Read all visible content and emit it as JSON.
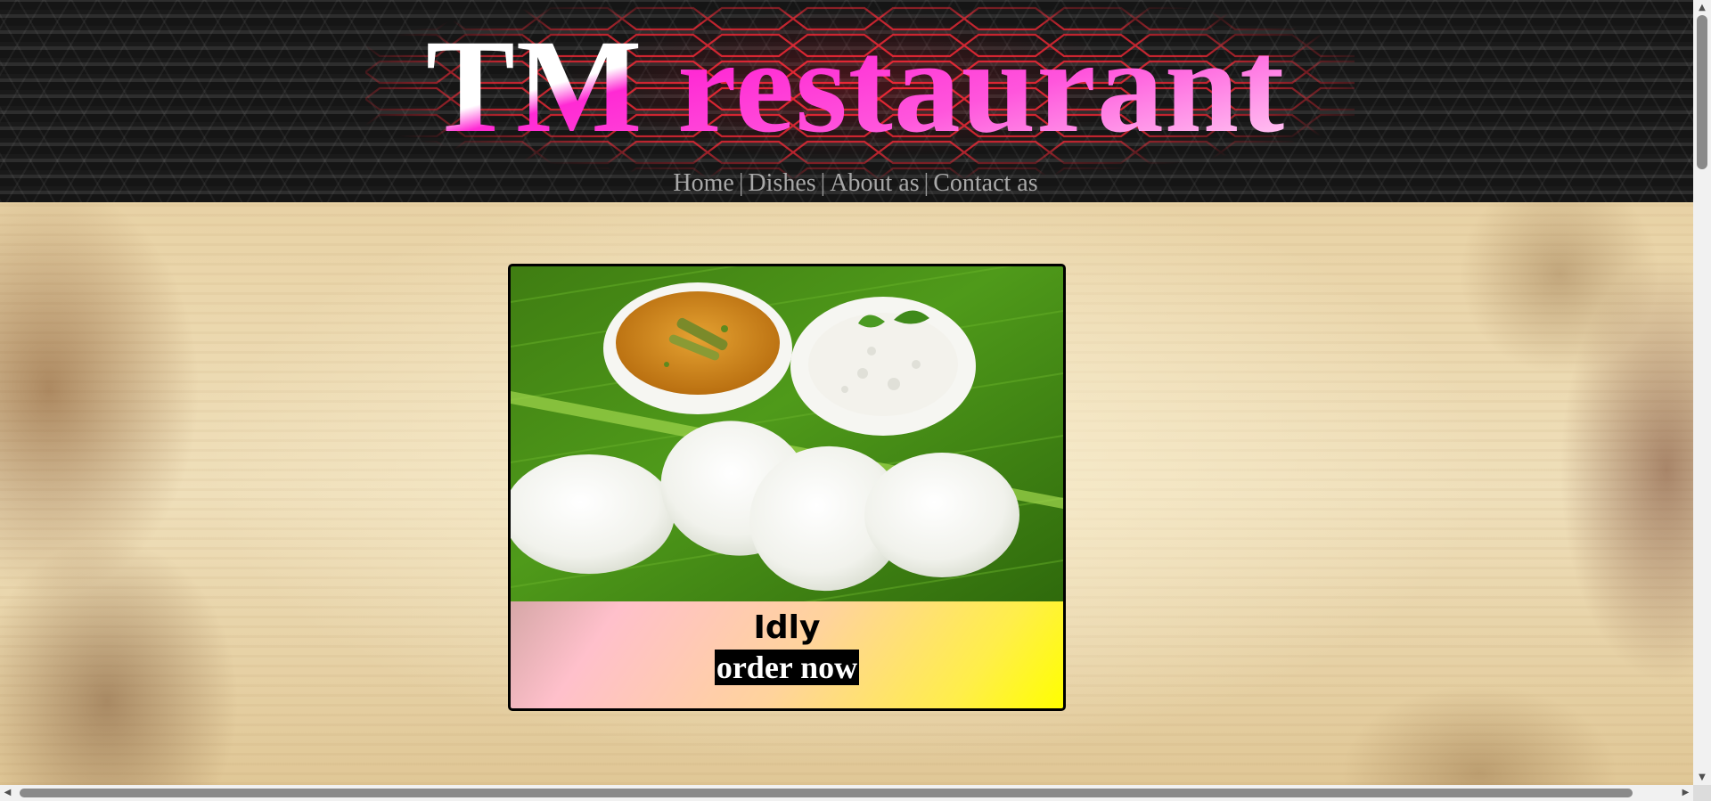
{
  "header": {
    "title": "TM restaurant",
    "nav": [
      {
        "label": "Home"
      },
      {
        "label": "Dishes"
      },
      {
        "label": "About as"
      },
      {
        "label": "Contact as"
      }
    ],
    "separator": "|"
  },
  "card": {
    "dish_name": "Idly",
    "order_label": "order now",
    "image_icon": "idly-food-photo"
  },
  "colors": {
    "title_accent": "#ff2ad4",
    "nav_text": "#a8a8a8",
    "caption_gradient_start": "#ffc0cb",
    "caption_gradient_end": "#ffff00",
    "order_button_bg": "#000000",
    "order_button_text": "#ffffff"
  }
}
